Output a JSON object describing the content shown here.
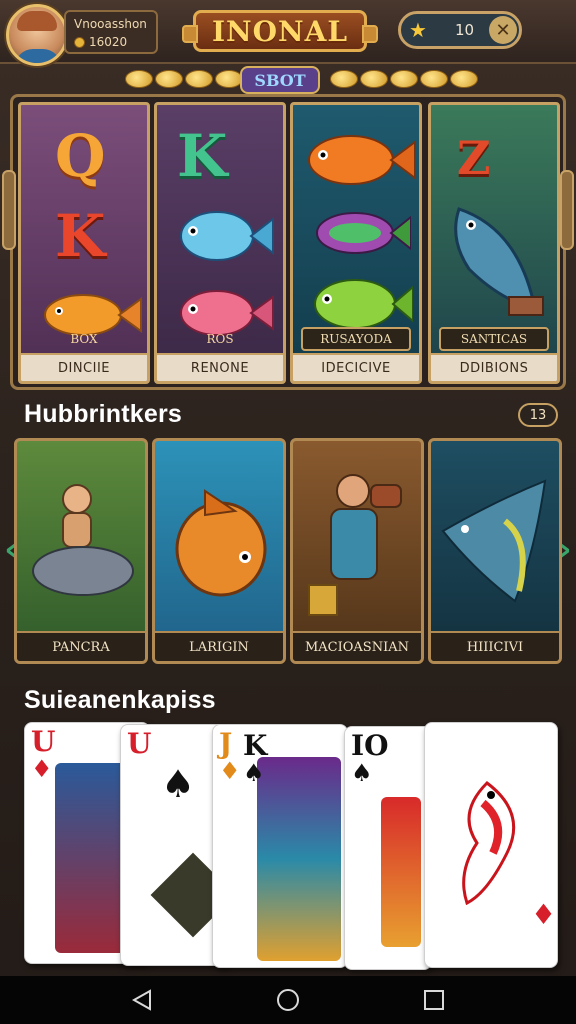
{
  "header": {
    "username": "Vnooasshon",
    "coins": "16020",
    "brand": "INONAL",
    "star_balance": "10",
    "close_label": "✕"
  },
  "slot": {
    "label": "SBOT",
    "reels": [
      {
        "plate": "BOX",
        "caption": "DINCIIE",
        "letters": [
          "Q",
          "K"
        ]
      },
      {
        "plate": "ROS",
        "caption": "RENONE",
        "letters": [
          "K"
        ]
      },
      {
        "plate": "RUSAYODA",
        "caption": "IDECICIVE",
        "letters": []
      },
      {
        "plate": "SANTICAS",
        "caption": "DDIBIONS",
        "letters": [
          "Z"
        ]
      }
    ]
  },
  "hub": {
    "title": "Hubbrintkers",
    "count": "13",
    "cards": [
      {
        "caption": "PANCRA"
      },
      {
        "caption": "LARIGIN"
      },
      {
        "caption": "MACIOASNIAN"
      },
      {
        "caption": "HIIICIVI"
      }
    ]
  },
  "cards_section": {
    "title": "Suieanenkapiss",
    "cards": [
      {
        "rank": "U",
        "suit": "♦",
        "color": "red"
      },
      {
        "rank": "U",
        "suit": "♠",
        "color": "black"
      },
      {
        "rank": "J",
        "suit": "♦",
        "color": "red"
      },
      {
        "rank": "K",
        "suit": "♠",
        "color": "black"
      },
      {
        "rank": "IO",
        "suit": "♠",
        "color": "black"
      },
      {
        "rank": "",
        "suit": "♦",
        "color": "red"
      }
    ]
  },
  "colors": {
    "background": "#2a211c",
    "frame_gold": "#c6a163",
    "brand_red": "#9a4e21",
    "nav_green": "#3aa56a"
  }
}
